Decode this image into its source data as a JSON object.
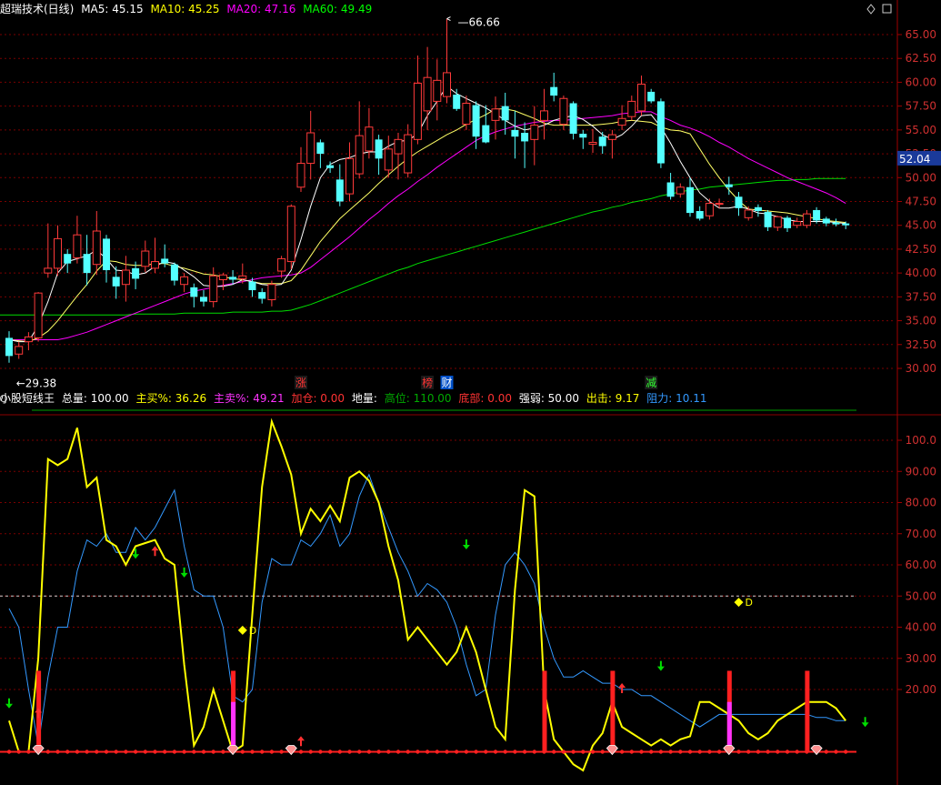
{
  "main": {
    "title": "超瑞技术(日线)",
    "ma": [
      {
        "label": "MA5: 45.15",
        "color": "#ffffff"
      },
      {
        "label": "MA10: 45.25",
        "color": "#ffff00"
      },
      {
        "label": "MA20: 47.16",
        "color": "#ff00ff"
      },
      {
        "label": "MA60: 49.49",
        "color": "#00ff00"
      }
    ],
    "high_label": "66.66",
    "low_label": "29.38",
    "price_tag": "52.04",
    "markers": [
      {
        "text": "涨",
        "color": "#ff3333",
        "bg": "#1a1a1a"
      },
      {
        "text": "榜",
        "color": "#ff3333",
        "bg": "#1a1a1a"
      },
      {
        "text": "财",
        "color": "#ffffff",
        "bg": "#0050c8"
      },
      {
        "text": "减",
        "color": "#33ff33",
        "bg": "#1a1a1a"
      }
    ]
  },
  "indicator": {
    "name": "小股短线王",
    "items": [
      {
        "label": "总量: 100.00",
        "color": "#ffffff"
      },
      {
        "label": "主买%: 36.26",
        "color": "#ffff00"
      },
      {
        "label": "主卖%: 49.21",
        "color": "#ff33ff"
      },
      {
        "label": "加仓: 0.00",
        "color": "#ff3333"
      },
      {
        "label": "地量:",
        "color": "#ffffff"
      },
      {
        "label": "高位: 110.00",
        "color": "#00aa00"
      },
      {
        "label": "底部: 0.00",
        "color": "#ff3333"
      },
      {
        "label": "强弱: 50.00",
        "color": "#ffffff"
      },
      {
        "label": "出击: 9.17",
        "color": "#ffff00"
      },
      {
        "label": "阻力: 10.11",
        "color": "#3399ff"
      }
    ],
    "d_label": "D"
  },
  "chart_data": [
    {
      "type": "candlestick",
      "ylim": [
        28.0,
        67.5
      ],
      "yticks": [
        "30.00",
        "32.50",
        "35.00",
        "37.50",
        "40.00",
        "42.50",
        "45.00",
        "47.50",
        "50.00",
        "52.50",
        "55.00",
        "57.50",
        "60.00",
        "62.50",
        "65.00"
      ],
      "candles": [
        {
          "o": 33.2,
          "c": 31.3,
          "h": 33.9,
          "l": 30.6
        },
        {
          "o": 31.5,
          "c": 32.3,
          "h": 32.8,
          "l": 31.0
        },
        {
          "o": 32.8,
          "c": 33.3,
          "h": 33.8,
          "l": 31.9
        },
        {
          "o": 33.2,
          "c": 37.9,
          "h": 38.0,
          "l": 32.8
        },
        {
          "o": 40.0,
          "c": 40.5,
          "h": 45.2,
          "l": 39.5
        },
        {
          "o": 40.5,
          "c": 43.6,
          "h": 45.0,
          "l": 39.7
        },
        {
          "o": 42.0,
          "c": 41.0,
          "h": 42.5,
          "l": 40.0
        },
        {
          "o": 41.6,
          "c": 44.0,
          "h": 46.0,
          "l": 41.0
        },
        {
          "o": 42.0,
          "c": 40.0,
          "h": 44.0,
          "l": 38.7
        },
        {
          "o": 40.9,
          "c": 44.4,
          "h": 46.5,
          "l": 39.8
        },
        {
          "o": 43.6,
          "c": 40.3,
          "h": 44.0,
          "l": 39.0
        },
        {
          "o": 39.6,
          "c": 38.6,
          "h": 40.7,
          "l": 37.3
        },
        {
          "o": 38.8,
          "c": 40.3,
          "h": 41.8,
          "l": 37.0
        },
        {
          "o": 40.5,
          "c": 39.4,
          "h": 41.2,
          "l": 38.3
        },
        {
          "o": 40.7,
          "c": 42.3,
          "h": 43.4,
          "l": 40.1
        },
        {
          "o": 40.5,
          "c": 41.2,
          "h": 43.7,
          "l": 40.0
        },
        {
          "o": 41.5,
          "c": 41.0,
          "h": 43.0,
          "l": 40.6
        },
        {
          "o": 40.9,
          "c": 39.2,
          "h": 41.1,
          "l": 38.7
        },
        {
          "o": 38.8,
          "c": 39.6,
          "h": 40.0,
          "l": 38.0
        },
        {
          "o": 38.5,
          "c": 37.5,
          "h": 38.9,
          "l": 36.4
        },
        {
          "o": 37.5,
          "c": 37.0,
          "h": 38.2,
          "l": 36.5
        },
        {
          "o": 37.0,
          "c": 39.7,
          "h": 40.6,
          "l": 36.4
        },
        {
          "o": 39.3,
          "c": 39.8,
          "h": 40.0,
          "l": 38.2
        },
        {
          "o": 39.6,
          "c": 39.3,
          "h": 40.3,
          "l": 38.8
        },
        {
          "o": 39.4,
          "c": 39.7,
          "h": 41.0,
          "l": 38.9
        },
        {
          "o": 39.1,
          "c": 38.2,
          "h": 39.5,
          "l": 37.5
        },
        {
          "o": 38.0,
          "c": 37.3,
          "h": 38.4,
          "l": 36.8
        },
        {
          "o": 37.2,
          "c": 38.8,
          "h": 39.2,
          "l": 36.5
        },
        {
          "o": 40.2,
          "c": 41.5,
          "h": 41.8,
          "l": 39.5
        },
        {
          "o": 41.2,
          "c": 47.0,
          "h": 47.2,
          "l": 40.4
        },
        {
          "o": 49.0,
          "c": 51.5,
          "h": 53.2,
          "l": 48.5
        },
        {
          "o": 51.5,
          "c": 54.7,
          "h": 57.0,
          "l": 49.8
        },
        {
          "o": 53.7,
          "c": 52.5,
          "h": 54.0,
          "l": 51.0
        },
        {
          "o": 51.3,
          "c": 51.0,
          "h": 51.7,
          "l": 50.5
        },
        {
          "o": 49.8,
          "c": 47.5,
          "h": 51.4,
          "l": 47.0
        },
        {
          "o": 48.3,
          "c": 52.0,
          "h": 53.7,
          "l": 47.5
        },
        {
          "o": 50.4,
          "c": 54.4,
          "h": 58.0,
          "l": 49.9
        },
        {
          "o": 52.8,
          "c": 55.3,
          "h": 57.3,
          "l": 52.0
        },
        {
          "o": 54.0,
          "c": 52.0,
          "h": 54.5,
          "l": 50.3
        },
        {
          "o": 50.8,
          "c": 53.0,
          "h": 54.4,
          "l": 50.0
        },
        {
          "o": 52.5,
          "c": 54.0,
          "h": 54.7,
          "l": 49.8
        },
        {
          "o": 50.5,
          "c": 54.5,
          "h": 55.6,
          "l": 50.0
        },
        {
          "o": 54.0,
          "c": 59.9,
          "h": 62.8,
          "l": 53.5
        },
        {
          "o": 57.0,
          "c": 60.5,
          "h": 63.7,
          "l": 55.0
        },
        {
          "o": 58.0,
          "c": 60.2,
          "h": 62.4,
          "l": 56.0
        },
        {
          "o": 58.5,
          "c": 61.0,
          "h": 66.66,
          "l": 57.8
        },
        {
          "o": 58.7,
          "c": 57.2,
          "h": 59.3,
          "l": 57.0
        },
        {
          "o": 55.6,
          "c": 57.8,
          "h": 58.6,
          "l": 55.0
        },
        {
          "o": 57.6,
          "c": 54.3,
          "h": 58.0,
          "l": 53.0
        },
        {
          "o": 55.5,
          "c": 53.7,
          "h": 57.6,
          "l": 53.6
        },
        {
          "o": 56.0,
          "c": 57.2,
          "h": 58.5,
          "l": 54.0
        },
        {
          "o": 57.5,
          "c": 56.0,
          "h": 58.9,
          "l": 54.5
        },
        {
          "o": 55.0,
          "c": 54.3,
          "h": 57.0,
          "l": 52.0
        },
        {
          "o": 54.7,
          "c": 53.8,
          "h": 55.8,
          "l": 51.0
        },
        {
          "o": 54.0,
          "c": 55.5,
          "h": 57.5,
          "l": 51.3
        },
        {
          "o": 56.0,
          "c": 57.0,
          "h": 59.3,
          "l": 54.0
        },
        {
          "o": 59.5,
          "c": 58.6,
          "h": 61.0,
          "l": 58.0
        },
        {
          "o": 55.6,
          "c": 58.3,
          "h": 58.6,
          "l": 55.0
        },
        {
          "o": 57.8,
          "c": 54.6,
          "h": 58.0,
          "l": 54.0
        },
        {
          "o": 54.6,
          "c": 54.2,
          "h": 55.0,
          "l": 53.0
        },
        {
          "o": 53.5,
          "c": 53.7,
          "h": 55.1,
          "l": 52.6
        },
        {
          "o": 54.3,
          "c": 53.3,
          "h": 54.8,
          "l": 52.5
        },
        {
          "o": 54.0,
          "c": 54.5,
          "h": 55.0,
          "l": 52.0
        },
        {
          "o": 55.5,
          "c": 56.2,
          "h": 57.6,
          "l": 55.0
        },
        {
          "o": 56.4,
          "c": 58.0,
          "h": 58.6,
          "l": 56.0
        },
        {
          "o": 57.0,
          "c": 59.8,
          "h": 60.7,
          "l": 56.5
        },
        {
          "o": 59.0,
          "c": 58.0,
          "h": 59.3,
          "l": 57.8
        },
        {
          "o": 58.0,
          "c": 51.5,
          "h": 58.3,
          "l": 51.0
        },
        {
          "o": 49.5,
          "c": 48.0,
          "h": 50.5,
          "l": 47.7
        },
        {
          "o": 48.3,
          "c": 49.0,
          "h": 49.4,
          "l": 47.9
        },
        {
          "o": 49.0,
          "c": 46.3,
          "h": 50.0,
          "l": 45.9
        },
        {
          "o": 46.5,
          "c": 45.7,
          "h": 47.0,
          "l": 45.5
        },
        {
          "o": 46.0,
          "c": 47.3,
          "h": 47.8,
          "l": 45.6
        },
        {
          "o": 47.2,
          "c": 47.3,
          "h": 47.8,
          "l": 46.8
        },
        {
          "o": 49.3,
          "c": 49.0,
          "h": 50.1,
          "l": 48.2
        },
        {
          "o": 48.0,
          "c": 46.8,
          "h": 48.5,
          "l": 46.0
        },
        {
          "o": 45.8,
          "c": 46.6,
          "h": 47.0,
          "l": 45.5
        },
        {
          "o": 46.9,
          "c": 46.5,
          "h": 47.2,
          "l": 45.9
        },
        {
          "o": 46.4,
          "c": 44.8,
          "h": 46.6,
          "l": 44.4
        },
        {
          "o": 44.8,
          "c": 45.9,
          "h": 46.0,
          "l": 44.4
        },
        {
          "o": 45.8,
          "c": 44.7,
          "h": 46.0,
          "l": 44.3
        },
        {
          "o": 45.0,
          "c": 45.4,
          "h": 45.8,
          "l": 44.7
        },
        {
          "o": 45.0,
          "c": 46.2,
          "h": 46.6,
          "l": 44.7
        },
        {
          "o": 46.6,
          "c": 45.5,
          "h": 46.9,
          "l": 45.2
        },
        {
          "o": 45.7,
          "c": 45.2,
          "h": 45.9,
          "l": 44.9
        },
        {
          "o": 45.3,
          "c": 45.1,
          "h": 45.7,
          "l": 44.9
        },
        {
          "o": 45.2,
          "c": 45.0,
          "h": 45.4,
          "l": 44.6
        }
      ],
      "ma5": [
        33.0,
        32.8,
        32.8,
        34.5,
        37.0,
        40.0,
        41.2,
        41.5,
        41.8,
        42.4,
        41.5,
        40.3,
        40.2,
        39.8,
        40.0,
        40.7,
        41.2,
        41.0,
        40.3,
        39.6,
        38.7,
        38.6,
        38.6,
        38.8,
        39.3,
        39.1,
        38.8,
        38.7,
        38.8,
        40.3,
        43.5,
        47.0,
        50.0,
        51.4,
        51.9,
        52.1,
        52.5,
        52.7,
        52.7,
        53.3,
        53.8,
        53.9,
        54.6,
        56.5,
        58.0,
        59.6,
        58.8,
        58.3,
        57.8,
        57.3,
        56.7,
        56.0,
        55.4,
        55.0,
        55.2,
        55.5,
        56.0,
        56.3,
        56.5,
        56.1,
        55.4,
        54.5,
        54.0,
        54.5,
        55.4,
        56.5,
        56.6,
        55.3,
        53.6,
        51.7,
        50.0,
        48.4,
        47.5,
        46.8,
        46.8,
        47.0,
        46.7,
        46.3,
        46.2,
        45.9,
        45.6,
        45.4,
        45.4,
        45.4,
        45.4,
        45.3,
        45.2
      ],
      "ma10": [
        33.0,
        32.9,
        32.8,
        33.2,
        33.9,
        35.0,
        36.3,
        37.6,
        38.8,
        40.2,
        41.3,
        41.2,
        40.9,
        40.8,
        40.8,
        41.0,
        41.0,
        40.7,
        40.5,
        40.2,
        39.9,
        39.8,
        39.6,
        39.4,
        39.3,
        39.1,
        38.9,
        38.9,
        38.9,
        39.2,
        40.3,
        41.8,
        43.3,
        44.5,
        45.7,
        46.6,
        47.5,
        48.4,
        49.4,
        50.3,
        51.2,
        52.0,
        52.7,
        53.3,
        53.9,
        54.5,
        55.0,
        55.6,
        56.1,
        56.6,
        57.2,
        57.2,
        57.0,
        56.6,
        56.2,
        55.7,
        55.5,
        55.5,
        55.5,
        55.5,
        55.5,
        55.6,
        55.7,
        55.9,
        56.0,
        55.9,
        55.8,
        55.3,
        55.0,
        54.9,
        54.6,
        53.0,
        51.4,
        50.0,
        48.7,
        47.6,
        46.7,
        46.6,
        46.5,
        46.4,
        46.3,
        46.1,
        45.9,
        45.7,
        45.5,
        45.4,
        45.3
      ],
      "ma20": [
        33.0,
        33.0,
        33.0,
        33.0,
        33.0,
        33.0,
        33.2,
        33.5,
        33.8,
        34.2,
        34.6,
        35.0,
        35.4,
        35.8,
        36.2,
        36.6,
        37.0,
        37.4,
        37.8,
        38.1,
        38.3,
        38.5,
        38.7,
        38.9,
        39.1,
        39.3,
        39.5,
        39.6,
        39.7,
        39.8,
        40.0,
        40.6,
        41.4,
        42.2,
        43.0,
        43.8,
        44.7,
        45.6,
        46.4,
        47.3,
        48.1,
        48.8,
        49.6,
        50.3,
        51.1,
        51.8,
        52.5,
        53.2,
        53.9,
        54.4,
        54.8,
        55.1,
        55.4,
        55.6,
        55.8,
        55.9,
        56.0,
        56.0,
        56.1,
        56.2,
        56.3,
        56.4,
        56.5,
        56.7,
        56.8,
        56.9,
        56.9,
        56.4,
        56.0,
        55.5,
        55.2,
        54.8,
        54.3,
        53.7,
        53.2,
        52.6,
        52.0,
        51.5,
        51.0,
        50.5,
        50.0,
        49.6,
        49.2,
        48.8,
        48.4,
        47.9,
        47.3
      ],
      "ma60": [
        35.6,
        35.6,
        35.6,
        35.6,
        35.6,
        35.6,
        35.6,
        35.6,
        35.6,
        35.6,
        35.6,
        35.6,
        35.6,
        35.7,
        35.7,
        35.7,
        35.7,
        35.7,
        35.8,
        35.8,
        35.8,
        35.8,
        35.8,
        35.9,
        35.9,
        35.9,
        35.9,
        36.0,
        36.0,
        36.1,
        36.4,
        36.7,
        37.1,
        37.5,
        37.9,
        38.3,
        38.7,
        39.1,
        39.5,
        39.9,
        40.3,
        40.6,
        41.0,
        41.3,
        41.6,
        41.9,
        42.2,
        42.5,
        42.8,
        43.1,
        43.4,
        43.7,
        44.0,
        44.3,
        44.6,
        44.9,
        45.2,
        45.5,
        45.8,
        46.1,
        46.4,
        46.6,
        46.9,
        47.1,
        47.4,
        47.6,
        47.8,
        48.1,
        48.3,
        48.5,
        48.7,
        48.8,
        49.0,
        49.1,
        49.2,
        49.3,
        49.4,
        49.5,
        49.6,
        49.7,
        49.7,
        49.8,
        49.8,
        49.9,
        49.9,
        49.9,
        49.9
      ]
    },
    {
      "type": "line",
      "ylim": [
        -8,
        112
      ],
      "yticks": [
        "20.00",
        "30.00",
        "40.00",
        "50.00",
        "60.00",
        "70.00",
        "80.00",
        "90.00",
        "100.0"
      ],
      "reference_line": 50,
      "series": [
        {
          "name": "出击",
          "color": "#ffff00",
          "values": [
            10,
            0,
            0,
            30,
            94,
            92,
            94,
            104,
            85,
            88,
            68,
            66,
            60,
            66,
            67,
            68,
            62,
            60,
            28,
            2,
            8,
            20,
            10,
            0,
            2,
            44,
            85,
            106,
            98,
            89,
            70,
            78,
            74,
            79,
            74,
            88,
            90,
            87,
            80,
            66,
            55,
            36,
            40,
            36,
            32,
            28,
            32,
            40,
            32,
            20,
            8,
            4,
            52,
            84,
            82,
            20,
            4,
            0,
            -4,
            -6,
            2,
            6,
            16,
            8,
            6,
            4,
            2,
            4,
            2,
            4,
            5,
            16,
            16,
            14,
            12,
            10,
            6,
            4,
            6,
            10,
            12,
            14,
            16,
            16,
            16,
            14,
            10
          ]
        },
        {
          "name": "阻力",
          "color": "#3399ff",
          "values": [
            46,
            40,
            20,
            2,
            24,
            40,
            40,
            58,
            68,
            66,
            70,
            64,
            64,
            72,
            68,
            72,
            78,
            84,
            66,
            52,
            50,
            50,
            40,
            18,
            16,
            20,
            48,
            62,
            60,
            60,
            68,
            66,
            70,
            76,
            66,
            70,
            82,
            89,
            80,
            72,
            64,
            58,
            50,
            54,
            52,
            48,
            40,
            28,
            18,
            20,
            44,
            60,
            64,
            60,
            54,
            40,
            30,
            24,
            24,
            26,
            24,
            22,
            22,
            20,
            20,
            18,
            18,
            16,
            14,
            12,
            10,
            8,
            10,
            12,
            12,
            12,
            12,
            12,
            12,
            12,
            12,
            12,
            12,
            11,
            11,
            10,
            10
          ]
        }
      ]
    }
  ]
}
